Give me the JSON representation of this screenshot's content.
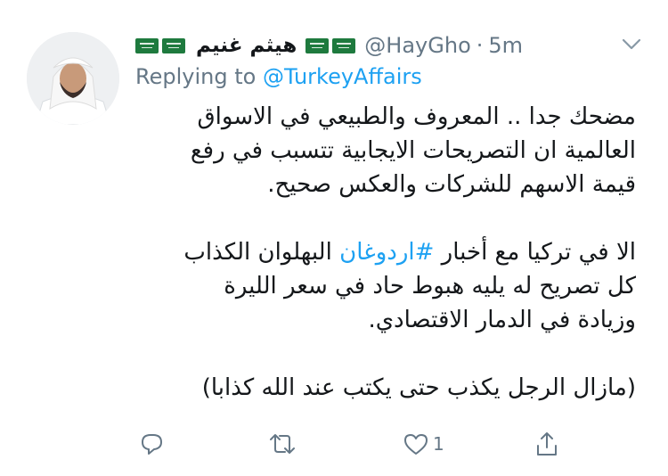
{
  "user": {
    "display_name": "هيثم غنيم",
    "handle": "@HayGho",
    "separator": "·",
    "time": "5m"
  },
  "icons": {
    "flag": "saudi-flag-emoji",
    "menu": "chevron-down-icon",
    "reply": "reply-icon",
    "retweet": "retweet-icon",
    "like": "heart-icon",
    "share": "share-icon"
  },
  "replying": {
    "prefix": "Replying to",
    "mention": "@TurkeyAffairs"
  },
  "tweet": {
    "p1_lines": [
      "مضحك جدا .. المعروف والطبيعي في الاسواق",
      "العالمية ان التصريحات الايجابية تتسبب في رفع",
      "قيمة الاسهم للشركات والعكس صحيح."
    ],
    "p2_line1_before": "الا في تركيا مع أخبار ",
    "p2_hashtag": "#اردوغان",
    "p2_line1_after": " البهلوان الكذاب",
    "p2_lines": [
      "كل تصريح له يليه هبوط حاد في سعر الليرة",
      "وزيادة في الدمار الاقتصادي."
    ],
    "p3": "(مازال الرجل يكذب حتى يكتب عند الله كذابا)"
  },
  "actions": {
    "like_count": "1"
  },
  "colors": {
    "text": "#14171a",
    "secondary": "#657786",
    "link": "#1da1f2",
    "flag_green": "#1e7a3e"
  }
}
